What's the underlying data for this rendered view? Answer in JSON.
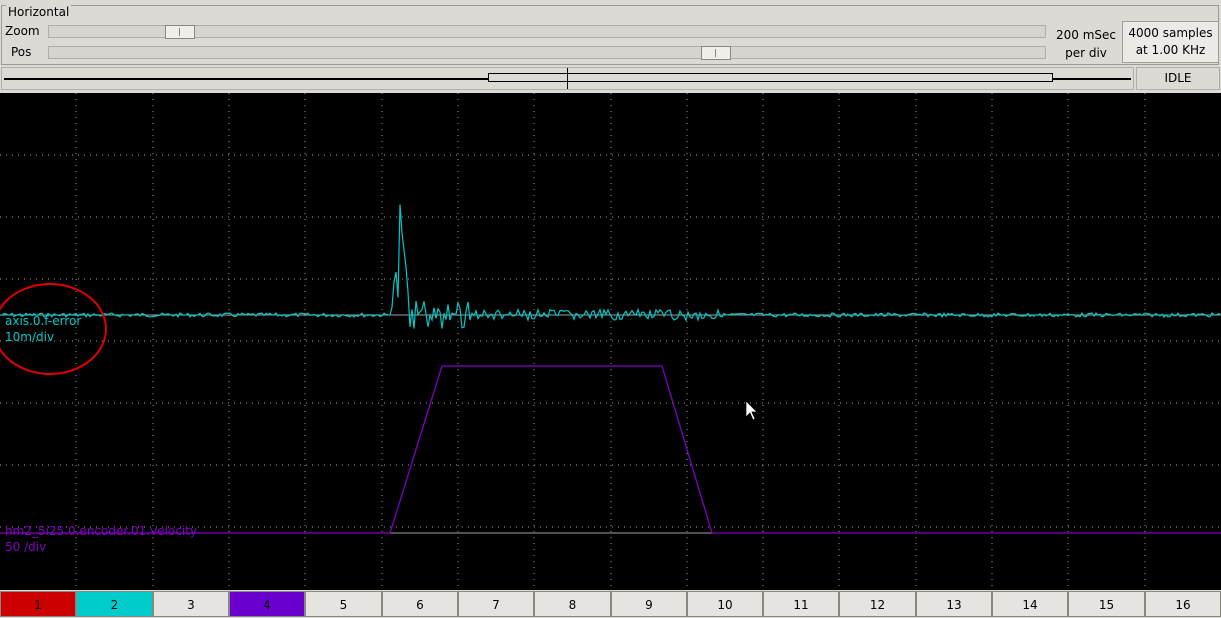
{
  "horizontal": {
    "title": "Horizontal",
    "zoom_label": "Zoom",
    "pos_label": "Pos",
    "zoom_value": 0.12,
    "pos_value": 0.675,
    "rate_line1": "200 mSec",
    "rate_line2": "per div",
    "samples_line1": "4000 samples",
    "samples_line2": "at 1.00 KHz"
  },
  "status": "IDLE",
  "traces": [
    {
      "name": "axis.0.f-error",
      "scale": "10m/div",
      "color": "#00c8c8"
    },
    {
      "name": "hm2_5i25.0.encoder.01.velocity",
      "scale": "50 /div",
      "color": "#8000c0"
    }
  ],
  "annotation_color": "#e00000",
  "channels": [
    {
      "label": "1",
      "color": "#cc0000"
    },
    {
      "label": "2",
      "color": "#00cccc"
    },
    {
      "label": "3",
      "color": ""
    },
    {
      "label": "4",
      "color": "#6a00d0"
    },
    {
      "label": "5",
      "color": ""
    },
    {
      "label": "6",
      "color": ""
    },
    {
      "label": "7",
      "color": ""
    },
    {
      "label": "8",
      "color": ""
    },
    {
      "label": "9",
      "color": ""
    },
    {
      "label": "10",
      "color": ""
    },
    {
      "label": "11",
      "color": ""
    },
    {
      "label": "12",
      "color": ""
    },
    {
      "label": "13",
      "color": ""
    },
    {
      "label": "14",
      "color": ""
    },
    {
      "label": "15",
      "color": ""
    },
    {
      "label": "16",
      "color": ""
    }
  ]
}
